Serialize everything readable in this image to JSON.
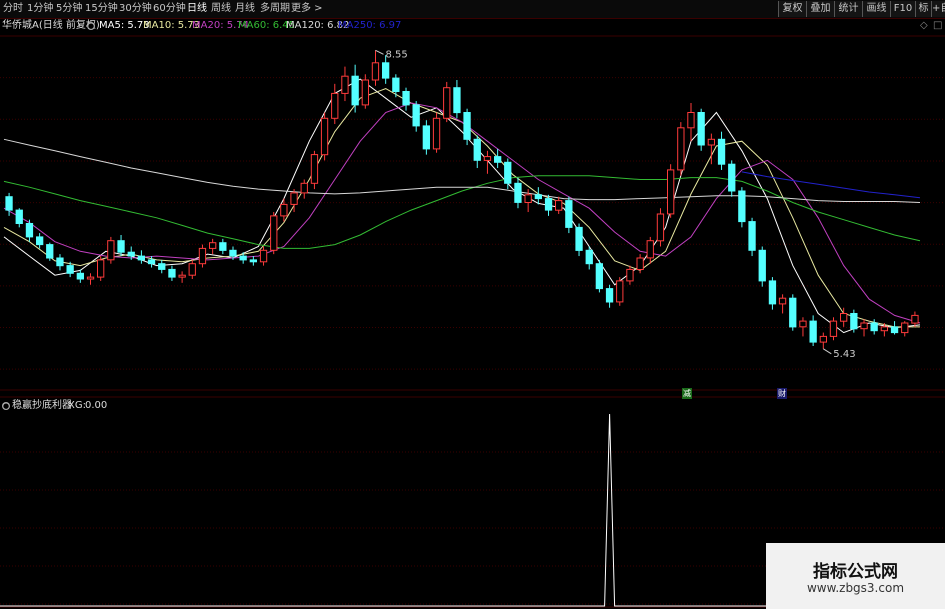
{
  "toolbar": {
    "periods": [
      "分时",
      "1分钟",
      "5分钟",
      "15分钟",
      "30分钟",
      "60分钟",
      "日线",
      "周线",
      "月线",
      "多周期",
      "更多 >"
    ],
    "active_period": "日线",
    "buttons": [
      "复权",
      "叠加",
      "统计",
      "画线",
      "F10",
      "标记",
      "+自"
    ]
  },
  "main_panel": {
    "stock_label": "华侨城A(日线 前复权)",
    "ma_indicators": [
      {
        "label": "MA5:",
        "value": "5.73",
        "color": "#ffffff"
      },
      {
        "label": "MA10:",
        "value": "5.73",
        "color": "#e8e8a0"
      },
      {
        "label": "MA20:",
        "value": "5.74",
        "color": "#c040c0"
      },
      {
        "label": "MA60:",
        "value": "6.45",
        "color": "#33bb33"
      },
      {
        "label": "MA120:",
        "value": "6.82",
        "color": "#d8d8d8"
      },
      {
        "label": "MA250:",
        "value": "6.97",
        "color": "#2222cc"
      }
    ],
    "high_marker": "8.55",
    "low_marker": "5.43",
    "event_badges": [
      "减",
      "财"
    ]
  },
  "sub_panel": {
    "indicator_name": "稳赢抄底利器",
    "xg_label": "XG:",
    "xg_value": "0.00"
  },
  "watermark": {
    "title": "指标公式网",
    "url": "www.zbgs3.com"
  },
  "colors": {
    "up": "#ff3b3b",
    "down": "#54ffff",
    "ma5": "#ffffff",
    "ma10": "#e8e8a0",
    "ma20": "#c040c0",
    "ma60": "#33bb33",
    "ma120": "#d8d8d8",
    "ma250": "#2222cc"
  },
  "chart_data": {
    "type": "candlestick",
    "price_range": [
      5.0,
      8.7
    ],
    "candles": [
      [
        7.02,
        7.06,
        6.82,
        6.88
      ],
      [
        6.88,
        6.9,
        6.7,
        6.74
      ],
      [
        6.74,
        6.78,
        6.55,
        6.6
      ],
      [
        6.6,
        6.64,
        6.48,
        6.52
      ],
      [
        6.52,
        6.54,
        6.35,
        6.38
      ],
      [
        6.38,
        6.42,
        6.25,
        6.3
      ],
      [
        6.3,
        6.34,
        6.18,
        6.22
      ],
      [
        6.22,
        6.26,
        6.12,
        6.16
      ],
      [
        6.16,
        6.22,
        6.1,
        6.18
      ],
      [
        6.18,
        6.4,
        6.14,
        6.36
      ],
      [
        6.36,
        6.6,
        6.32,
        6.56
      ],
      [
        6.56,
        6.62,
        6.4,
        6.44
      ],
      [
        6.44,
        6.5,
        6.36,
        6.4
      ],
      [
        6.4,
        6.46,
        6.32,
        6.36
      ],
      [
        6.36,
        6.4,
        6.28,
        6.32
      ],
      [
        6.32,
        6.36,
        6.22,
        6.26
      ],
      [
        6.26,
        6.3,
        6.14,
        6.18
      ],
      [
        6.18,
        6.24,
        6.12,
        6.2
      ],
      [
        6.2,
        6.36,
        6.16,
        6.32
      ],
      [
        6.32,
        6.52,
        6.28,
        6.48
      ],
      [
        6.48,
        6.58,
        6.42,
        6.54
      ],
      [
        6.54,
        6.58,
        6.42,
        6.46
      ],
      [
        6.46,
        6.5,
        6.36,
        6.4
      ],
      [
        6.4,
        6.44,
        6.32,
        6.36
      ],
      [
        6.36,
        6.4,
        6.3,
        6.34
      ],
      [
        6.34,
        6.5,
        6.3,
        6.46
      ],
      [
        6.46,
        6.86,
        6.42,
        6.82
      ],
      [
        6.82,
        7.0,
        6.76,
        6.94
      ],
      [
        6.94,
        7.1,
        6.86,
        7.06
      ],
      [
        7.06,
        7.2,
        7.0,
        7.16
      ],
      [
        7.16,
        7.5,
        7.1,
        7.46
      ],
      [
        7.46,
        7.9,
        7.4,
        7.84
      ],
      [
        7.84,
        8.2,
        7.78,
        8.1
      ],
      [
        8.1,
        8.38,
        8.02,
        8.28
      ],
      [
        8.28,
        8.4,
        7.9,
        7.98
      ],
      [
        7.98,
        8.3,
        7.94,
        8.24
      ],
      [
        8.24,
        8.55,
        8.18,
        8.42
      ],
      [
        8.42,
        8.5,
        8.2,
        8.26
      ],
      [
        8.26,
        8.3,
        8.06,
        8.12
      ],
      [
        8.12,
        8.16,
        7.92,
        7.98
      ],
      [
        7.98,
        8.02,
        7.7,
        7.76
      ],
      [
        7.76,
        7.82,
        7.46,
        7.52
      ],
      [
        7.52,
        7.9,
        7.48,
        7.84
      ],
      [
        7.84,
        8.22,
        7.8,
        8.16
      ],
      [
        8.16,
        8.24,
        7.84,
        7.9
      ],
      [
        7.9,
        7.94,
        7.56,
        7.62
      ],
      [
        7.62,
        7.66,
        7.32,
        7.4
      ],
      [
        7.4,
        7.5,
        7.26,
        7.44
      ],
      [
        7.44,
        7.52,
        7.32,
        7.38
      ],
      [
        7.38,
        7.42,
        7.1,
        7.16
      ],
      [
        7.16,
        7.22,
        6.9,
        6.96
      ],
      [
        6.96,
        7.1,
        6.86,
        7.04
      ],
      [
        7.04,
        7.12,
        6.94,
        7.0
      ],
      [
        7.0,
        7.04,
        6.82,
        6.88
      ],
      [
        6.88,
        7.02,
        6.84,
        6.98
      ],
      [
        6.98,
        7.02,
        6.64,
        6.7
      ],
      [
        6.7,
        6.74,
        6.4,
        6.46
      ],
      [
        6.46,
        6.5,
        6.26,
        6.32
      ],
      [
        6.32,
        6.36,
        6.02,
        6.06
      ],
      [
        6.06,
        6.1,
        5.86,
        5.92
      ],
      [
        5.92,
        6.18,
        5.88,
        6.14
      ],
      [
        6.14,
        6.3,
        6.1,
        6.26
      ],
      [
        6.26,
        6.42,
        6.22,
        6.38
      ],
      [
        6.38,
        6.6,
        6.32,
        6.56
      ],
      [
        6.56,
        6.9,
        6.5,
        6.84
      ],
      [
        6.84,
        7.36,
        6.8,
        7.3
      ],
      [
        7.3,
        7.8,
        7.24,
        7.74
      ],
      [
        7.74,
        8.0,
        7.6,
        7.9
      ],
      [
        7.9,
        7.94,
        7.5,
        7.56
      ],
      [
        7.56,
        7.68,
        7.36,
        7.62
      ],
      [
        7.62,
        7.7,
        7.3,
        7.36
      ],
      [
        7.36,
        7.4,
        7.02,
        7.08
      ],
      [
        7.08,
        7.12,
        6.7,
        6.76
      ],
      [
        6.76,
        6.8,
        6.4,
        6.46
      ],
      [
        6.46,
        6.5,
        6.08,
        6.14
      ],
      [
        6.14,
        6.18,
        5.84,
        5.9
      ],
      [
        5.9,
        6.0,
        5.8,
        5.96
      ],
      [
        5.96,
        6.0,
        5.62,
        5.66
      ],
      [
        5.66,
        5.76,
        5.56,
        5.72
      ],
      [
        5.72,
        5.78,
        5.46,
        5.5
      ],
      [
        5.5,
        5.6,
        5.43,
        5.56
      ],
      [
        5.56,
        5.76,
        5.52,
        5.72
      ],
      [
        5.72,
        5.86,
        5.66,
        5.8
      ],
      [
        5.8,
        5.84,
        5.6,
        5.64
      ],
      [
        5.64,
        5.74,
        5.56,
        5.7
      ],
      [
        5.7,
        5.74,
        5.58,
        5.62
      ],
      [
        5.62,
        5.7,
        5.56,
        5.66
      ],
      [
        5.66,
        5.72,
        5.58,
        5.6
      ],
      [
        5.6,
        5.72,
        5.56,
        5.7
      ],
      [
        5.7,
        5.82,
        5.66,
        5.78
      ]
    ],
    "ma_series": [
      {
        "name": "MA5",
        "color": "#ffffff",
        "values": [
          6.6,
          6.4,
          6.2,
          6.25,
          6.45,
          6.4,
          6.3,
          6.32,
          6.42,
          6.38,
          6.5,
          7.0,
          7.6,
          8.1,
          8.25,
          8.05,
          7.85,
          7.95,
          7.7,
          7.4,
          7.1,
          6.95,
          6.9,
          6.5,
          6.1,
          6.3,
          6.7,
          7.6,
          7.9,
          7.5,
          7.0,
          6.3,
          5.8,
          5.6,
          5.7,
          5.65,
          5.68
        ]
      },
      {
        "name": "MA10",
        "color": "#e8e8a0",
        "values": [
          6.7,
          6.55,
          6.35,
          6.3,
          6.38,
          6.42,
          6.36,
          6.34,
          6.38,
          6.4,
          6.45,
          6.75,
          7.2,
          7.7,
          8.05,
          8.15,
          8.0,
          7.9,
          7.8,
          7.55,
          7.25,
          7.05,
          6.95,
          6.7,
          6.35,
          6.25,
          6.45,
          7.05,
          7.55,
          7.6,
          7.35,
          6.8,
          6.2,
          5.8,
          5.72,
          5.66,
          5.66
        ]
      },
      {
        "name": "MA20",
        "color": "#c040c0",
        "values": [
          6.9,
          6.75,
          6.55,
          6.45,
          6.4,
          6.38,
          6.4,
          6.38,
          6.36,
          6.38,
          6.4,
          6.5,
          6.8,
          7.2,
          7.6,
          7.9,
          8.0,
          7.95,
          7.8,
          7.6,
          7.4,
          7.2,
          7.05,
          6.9,
          6.65,
          6.45,
          6.4,
          6.6,
          7.0,
          7.3,
          7.4,
          7.2,
          6.8,
          6.3,
          5.95,
          5.78,
          5.7
        ]
      },
      {
        "name": "MA60",
        "color": "#33bb33",
        "values": [
          7.18,
          7.12,
          7.05,
          6.98,
          6.92,
          6.86,
          6.8,
          6.72,
          6.64,
          6.58,
          6.52,
          6.48,
          6.48,
          6.52,
          6.62,
          6.76,
          6.88,
          6.98,
          7.08,
          7.16,
          7.22,
          7.24,
          7.24,
          7.24,
          7.22,
          7.2,
          7.2,
          7.22,
          7.22,
          7.18,
          7.08,
          6.96,
          6.86,
          6.78,
          6.7,
          6.62,
          6.56
        ]
      },
      {
        "name": "MA120",
        "color": "#d8d8d8",
        "values": [
          7.62,
          7.56,
          7.5,
          7.44,
          7.38,
          7.32,
          7.27,
          7.22,
          7.17,
          7.13,
          7.1,
          7.08,
          7.06,
          7.05,
          7.06,
          7.08,
          7.1,
          7.12,
          7.12,
          7.12,
          7.08,
          7.04,
          7.0,
          6.99,
          6.99,
          7.0,
          7.01,
          7.02,
          7.03,
          7.03,
          7.02,
          7.0,
          6.98,
          6.97,
          6.97,
          6.97,
          6.96
        ]
      },
      {
        "name": "MA250",
        "color": "#2222cc",
        "values": [
          null,
          null,
          null,
          null,
          null,
          null,
          null,
          null,
          null,
          null,
          null,
          null,
          null,
          null,
          null,
          null,
          null,
          null,
          null,
          null,
          null,
          null,
          null,
          null,
          null,
          null,
          null,
          null,
          null,
          7.28,
          7.23,
          7.19,
          7.15,
          7.11,
          7.07,
          7.04,
          7.01
        ]
      }
    ],
    "xg_signal": {
      "index": 59,
      "value": 1
    }
  }
}
